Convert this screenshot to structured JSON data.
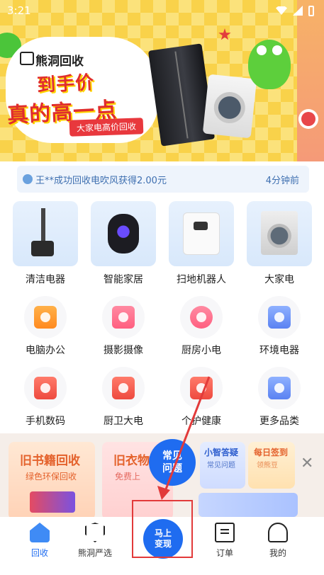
{
  "status_bar": {
    "time": "3:21"
  },
  "banner": {
    "brand": "熊洞回收",
    "line1": "到手价",
    "line2": "真的高一点",
    "tagline": "大家电高价回收"
  },
  "ticker": {
    "message": "王**成功回收电吹风获得2.00元",
    "time_ago": "4分钟前"
  },
  "categories_large": [
    {
      "label": "清洁电器"
    },
    {
      "label": "智能家居"
    },
    {
      "label": "扫地机器人"
    },
    {
      "label": "大家电"
    }
  ],
  "categories_small_row1": [
    {
      "label": "电脑办公"
    },
    {
      "label": "摄影摄像"
    },
    {
      "label": "厨房小电"
    },
    {
      "label": "环境电器"
    }
  ],
  "categories_small_row2": [
    {
      "label": "手机数码"
    },
    {
      "label": "厨卫大电"
    },
    {
      "label": "个护健康"
    },
    {
      "label": "更多品类"
    }
  ],
  "promo": {
    "book_title": "旧书籍回收",
    "book_sub": "绿色环保回收",
    "cloth_title": "旧衣物",
    "cloth_sub": "免费上",
    "faq_bubble": "常见问题",
    "help_title": "小智答疑",
    "help_sub": "常见问题",
    "sign_title": "每日签到",
    "sign_sub": "领熊豆"
  },
  "tabbar": {
    "tabs": [
      {
        "label": "回收",
        "icon": "home-icon"
      },
      {
        "label": "熊洞严选",
        "icon": "shield-star-icon"
      },
      {
        "label": "马上变现",
        "icon": "sell-button"
      },
      {
        "label": "订单",
        "icon": "order-icon"
      },
      {
        "label": "我的",
        "icon": "profile-icon"
      }
    ]
  },
  "colors": {
    "accent": "#1f6cf0",
    "highlight": "#e23a3a",
    "banner_yellow": "#f9d24a"
  }
}
